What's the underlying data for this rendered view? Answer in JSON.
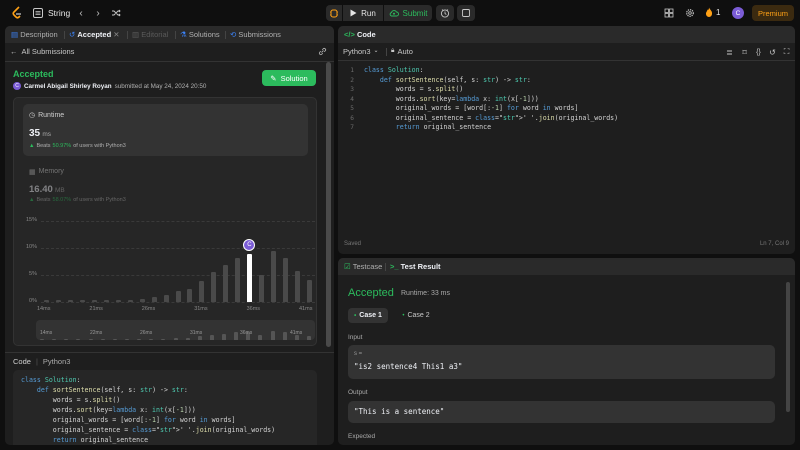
{
  "topbar": {
    "problem_list": "String",
    "run": "Run",
    "submit": "Submit",
    "streak": "1",
    "avatar": "C",
    "premium": "Premium"
  },
  "left": {
    "tabs": [
      "Description",
      "Accepted",
      "Editorial",
      "Solutions",
      "Submissions"
    ],
    "back": "All Submissions",
    "status": "Accepted",
    "user": "Carmel Abigail Shirley Royan",
    "submitted": "submitted at May 24, 2024 20:50",
    "solution_btn": "Solution",
    "runtime": {
      "label": "Runtime",
      "value": "35",
      "unit": "ms",
      "beats_pre": "Beats",
      "beats_pct": "50.97%",
      "beats_post": "of users with Python3"
    },
    "memory": {
      "label": "Memory",
      "value": "16.40",
      "unit": "MB",
      "beats_pre": "Beats",
      "beats_pct": "58.07%",
      "beats_post": "of users with Python3"
    },
    "code_header": "Code",
    "code_lang": "Python3"
  },
  "chart_data": {
    "type": "bar",
    "y_ticks": [
      "15%",
      "10%",
      "5%",
      "0%"
    ],
    "x_ticks": [
      "14ms",
      "21ms",
      "26ms",
      "31ms",
      "36ms",
      "41ms"
    ],
    "mini_ticks": [
      "14ms",
      "22ms",
      "26ms",
      "31ms",
      "36ms",
      "41ms"
    ],
    "ylim": [
      0,
      15
    ],
    "values": [
      0.3,
      0.3,
      0.3,
      0.3,
      0.3,
      0.3,
      0.4,
      0.4,
      0.6,
      0.9,
      1.3,
      2.0,
      2.5,
      3.8,
      5.5,
      6.8,
      8.2,
      8.8,
      5.0,
      9.5,
      8.2,
      5.8,
      4.0
    ],
    "highlight_index": 17,
    "marker_label": "C"
  },
  "editor": {
    "title": "Code",
    "lang": "Python3",
    "mode": "Auto",
    "saved": "Saved",
    "position": "Ln 7, Col 9"
  },
  "code_lines": [
    "class Solution:",
    "    def sortSentence(self, s: str) -> str:",
    "        words = s.split()",
    "        words.sort(key=lambda x: int(x[-1]))",
    "        original_words = [word[:-1] for word in words]",
    "        original_sentence = ' '.join(original_words)",
    "        return original_sentence"
  ],
  "console": {
    "tabs": [
      "Testcase",
      "Test Result"
    ],
    "status": "Accepted",
    "runtime": "Runtime: 33 ms",
    "cases": [
      "Case 1",
      "Case 2"
    ],
    "input_label": "Input",
    "var_name": "s =",
    "input_value": "\"is2 sentence4 This1 a3\"",
    "output_label": "Output",
    "output_value": "\"This is a sentence\"",
    "expected_label": "Expected"
  }
}
